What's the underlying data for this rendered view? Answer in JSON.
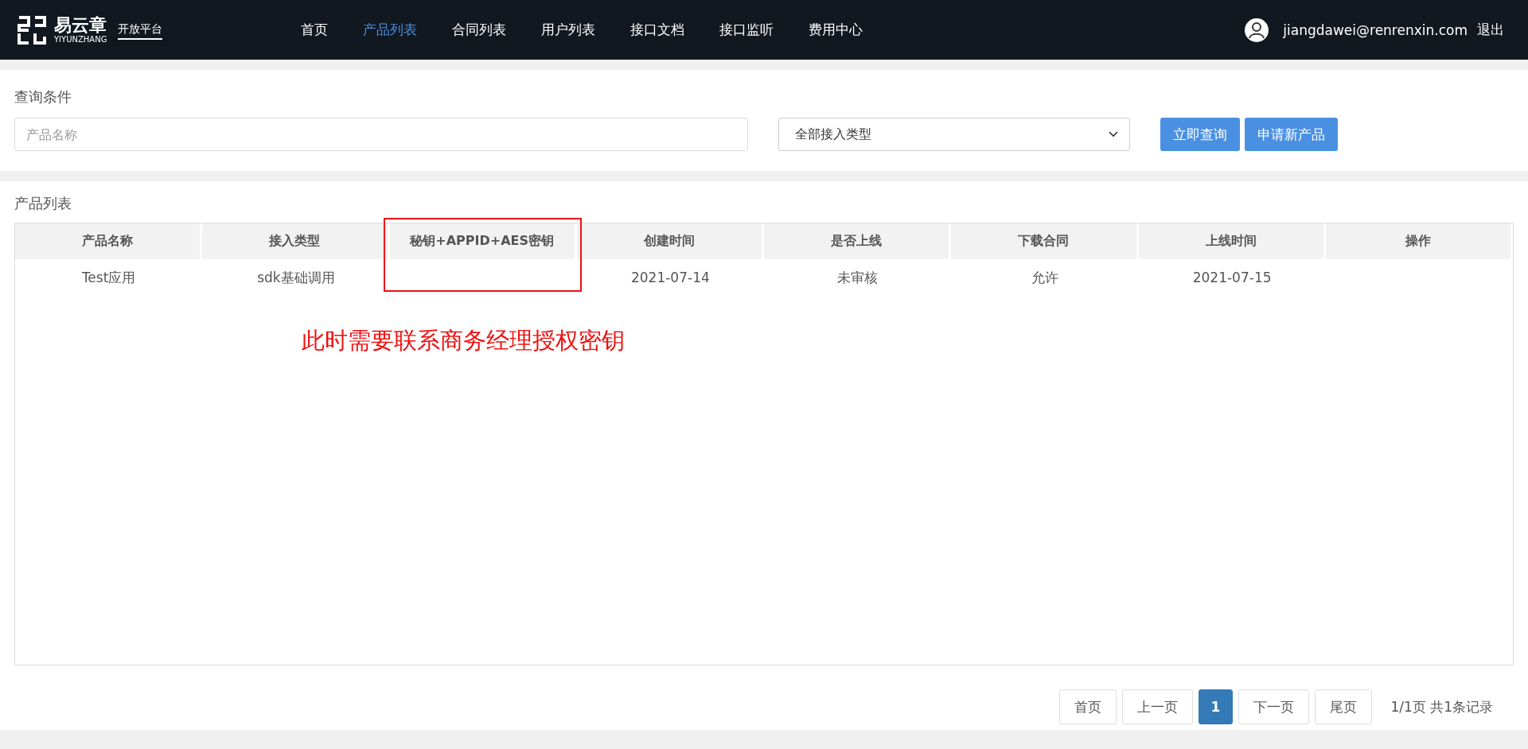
{
  "header": {
    "logo": {
      "name": "易云章",
      "subtitle": "YIYUNZHANG",
      "badge": "开放平台"
    },
    "nav": [
      {
        "label": "首页",
        "selected": false
      },
      {
        "label": "产品列表",
        "selected": true
      },
      {
        "label": "合同列表",
        "selected": false
      },
      {
        "label": "用户列表",
        "selected": false
      },
      {
        "label": "接口文档",
        "selected": false
      },
      {
        "label": "接口监听",
        "selected": false
      },
      {
        "label": "费用中心",
        "selected": false
      }
    ],
    "user": {
      "email": "jiangdawei@renrenxin.com",
      "logout": "退出"
    }
  },
  "query": {
    "title": "查询条件",
    "name_field": {
      "placeholder": "产品名称"
    },
    "type_select": {
      "value": "全部接入类型"
    },
    "buttons": [
      "立即查询",
      "申请新产品"
    ]
  },
  "product_list": {
    "title": "产品列表",
    "columns": [
      {
        "label": "产品名称",
        "highlighted": false
      },
      {
        "label": "接入类型",
        "highlighted": false
      },
      {
        "label": "秘钥+APPID+AES密钥",
        "highlighted": true
      },
      {
        "label": "创建时间",
        "highlighted": false
      },
      {
        "label": "是否上线",
        "highlighted": false
      },
      {
        "label": "下载合同",
        "highlighted": false
      },
      {
        "label": "上线时间",
        "highlighted": false
      },
      {
        "label": "操作",
        "highlighted": false
      }
    ],
    "rows": [
      [
        "Test应用",
        "sdk基础调用",
        "",
        "2021-07-14",
        "未审核",
        "允许",
        "2021-07-15",
        ""
      ]
    ],
    "annotation": "此时需要联系商务经理授权密钥"
  },
  "pagination": {
    "pages": [
      {
        "label": "首页",
        "kind": "nav",
        "selected": false
      },
      {
        "label": "上一页",
        "kind": "nav",
        "selected": false
      },
      {
        "label": "1",
        "kind": "page",
        "selected": true
      },
      {
        "label": "下一页",
        "kind": "nav",
        "selected": false
      },
      {
        "label": "尾页",
        "kind": "nav",
        "selected": false
      }
    ],
    "summary": "1/1页 共1条记录"
  }
}
